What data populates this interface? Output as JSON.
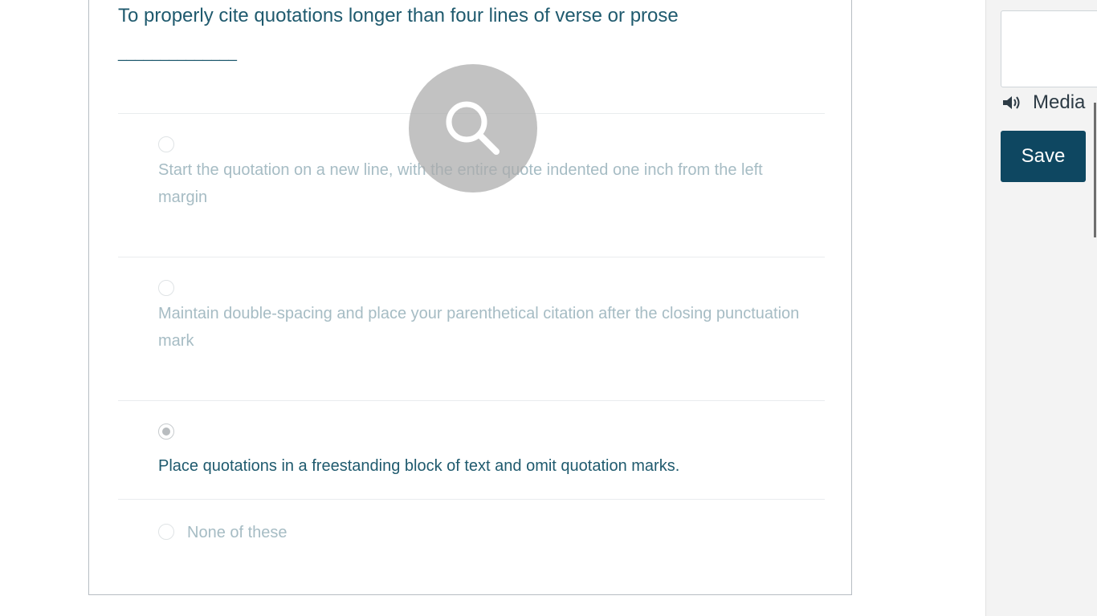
{
  "question": {
    "text": "To properly cite quotations longer than four lines of verse or prose",
    "blank": "______________",
    "options": [
      {
        "label": "Start the quotation on a new line, with the entire quote indented one inch from the left margin",
        "selected": false
      },
      {
        "label": "Maintain double-spacing and place your parenthetical citation after the closing punctuation mark",
        "selected": false
      },
      {
        "label": "Place quotations in a freestanding block of text and omit quotation marks.",
        "selected": true
      },
      {
        "label": "None of these",
        "selected": false
      }
    ]
  },
  "overlay": {
    "icon": "search-icon"
  },
  "sidebar": {
    "media_label": "Media",
    "media_icon": "speaker-icon",
    "save_label": "Save"
  },
  "colors": {
    "question_text": "#1f5a6e",
    "option_disabled": "#a6bcc4",
    "save_button": "#0e4761",
    "sidebar_bg": "#f3f3f3"
  }
}
